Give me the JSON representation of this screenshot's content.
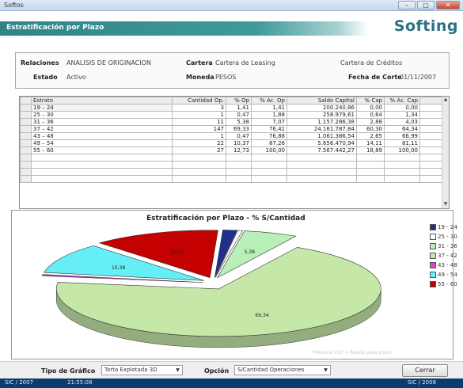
{
  "window": {
    "title": "Softos",
    "btn_min": "–",
    "btn_max": "□",
    "btn_close": "✕"
  },
  "header": {
    "title": "Estratificación por Plazo",
    "logo": "Softing"
  },
  "info": {
    "relaciones_label": "Relaciones",
    "relaciones_value": "ANALISIS DE ORIGINACION",
    "cartera_label": "Cartera",
    "cartera_value": "Cartera de Leasing",
    "cartera2_value": "Cartera de Créditos",
    "estado_label": "Estado",
    "estado_value": "Activo",
    "moneda_label": "Moneda",
    "moneda_value": "PESOS",
    "fecha_label": "Fecha de Corte",
    "fecha_value": "01/11/2007"
  },
  "table": {
    "headers": [
      "Estrato",
      "Cantidad Op.",
      "% Op",
      "% Ac. Op",
      "Saldo Capital",
      "% Cap",
      "% Ac. Cap"
    ],
    "rows": [
      [
        "19 – 24",
        "3",
        "1,41",
        "1,41",
        "200.240,86",
        "0,00",
        "0,00"
      ],
      [
        "25 – 30",
        "1",
        "0,47",
        "1,88",
        "258.979,61",
        "0,64",
        "1,34"
      ],
      [
        "31 – 36",
        "11",
        "5,38",
        "7,07",
        "1.157.286,38",
        "2,88",
        "4,03"
      ],
      [
        "37 – 42",
        "147",
        "69,33",
        "76,41",
        "24.161.787,84",
        "60,30",
        "64,34"
      ],
      [
        "43 – 48",
        "1",
        "0,47",
        "76,88",
        "1.061.386,54",
        "2,65",
        "66,99"
      ],
      [
        "49 – 54",
        "22",
        "10,37",
        "87,26",
        "5.656.470,94",
        "14,11",
        "81,11"
      ],
      [
        "55 – 60",
        "27",
        "12,73",
        "100,00",
        "7.567.442,27",
        "18,89",
        "100,00"
      ]
    ],
    "blank_rows": 4
  },
  "chart_data": {
    "type": "pie",
    "title": "Estratificación por Plazo - % S/Cantidad",
    "categories": [
      "19 - 24",
      "25 - 30",
      "31 - 36",
      "37 - 42",
      "43 - 48",
      "49 - 54",
      "55 - 60"
    ],
    "values": [
      1.41,
      0.47,
      5.38,
      69.33,
      0.47,
      10.37,
      12.73
    ],
    "data_labels": [
      "",
      "",
      "5,38",
      "69,34",
      "",
      "10,38",
      "12,73"
    ],
    "colors": [
      "#1f2f8c",
      "#ffffff",
      "#b9f0b9",
      "#c5e7a8",
      "#e043e0",
      "#66eef7",
      "#c40000"
    ],
    "exploded": true,
    "legend_position": "right",
    "footnote": "Presione Ctrl + Rueda para zoom"
  },
  "bottom": {
    "tipo_label": "Tipo de Gráfico",
    "tipo_value": "Torta Explotada 3D",
    "opcion_label": "Opción",
    "opcion_value": "S/Cantidad Operaciones",
    "cerrar_label": "Cerrar"
  },
  "status": {
    "left": "SIC / 2007",
    "middle": "21:55:08",
    "right": "SIC / 2008"
  }
}
